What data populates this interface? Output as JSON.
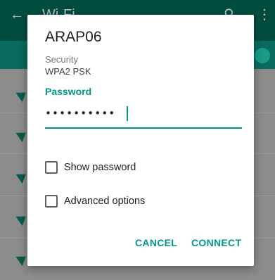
{
  "background": {
    "app_title": "Wi-Fi",
    "back_icon": "arrow-back-icon",
    "search_icon": "search-icon",
    "more_icon": "more-vert-icon"
  },
  "dialog": {
    "network_name": "ARAP06",
    "security_label": "Security",
    "security_value": "WPA2 PSK",
    "password_label": "Password",
    "password_value": "••••••••••",
    "show_password_label": "Show password",
    "show_password_checked": false,
    "advanced_options_label": "Advanced options",
    "advanced_options_checked": false,
    "cancel_label": "CANCEL",
    "connect_label": "CONNECT"
  },
  "colors": {
    "accent": "#009688",
    "appbar": "#004d40"
  }
}
